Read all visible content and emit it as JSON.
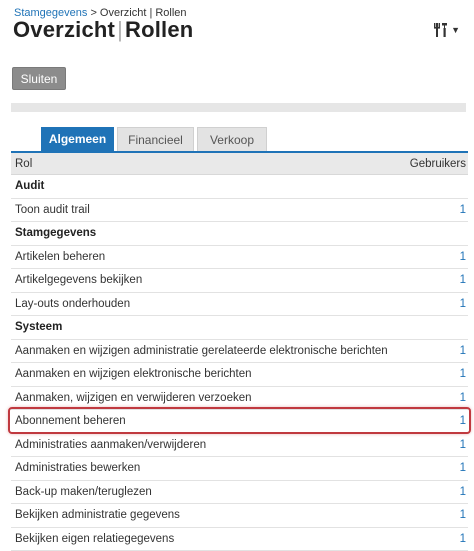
{
  "breadcrumb": {
    "link": "Stamgegevens",
    "rest": "> Overzicht | Rollen"
  },
  "title": {
    "main": "Overzicht",
    "separator": "|",
    "sub": "Rollen"
  },
  "tools": {
    "icon": "tools-icon",
    "caret": "▼"
  },
  "buttons": {
    "close": "Sluiten"
  },
  "tabs": [
    {
      "label": "Algemeen",
      "active": true
    },
    {
      "label": "Financieel",
      "active": false
    },
    {
      "label": "Verkoop",
      "active": false
    }
  ],
  "table": {
    "columns": {
      "role": "Rol",
      "users": "Gebruikers"
    },
    "rows": [
      {
        "label": "Audit",
        "value": "",
        "group": true
      },
      {
        "label": "Toon audit trail",
        "value": "1"
      },
      {
        "label": "Stamgegevens",
        "value": "",
        "group": true
      },
      {
        "label": "Artikelen beheren",
        "value": "1"
      },
      {
        "label": "Artikelgegevens bekijken",
        "value": "1"
      },
      {
        "label": "Lay-outs onderhouden",
        "value": "1"
      },
      {
        "label": "Systeem",
        "value": "",
        "group": true
      },
      {
        "label": "Aanmaken en wijzigen administratie gerelateerde elektronische berichten",
        "value": "1"
      },
      {
        "label": "Aanmaken en wijzigen elektronische berichten",
        "value": "1"
      },
      {
        "label": "Aanmaken, wijzigen en verwijderen verzoeken",
        "value": "1"
      },
      {
        "label": "Abonnement beheren",
        "value": "1",
        "highlighted": true
      },
      {
        "label": "Administraties aanmaken/verwijderen",
        "value": "1"
      },
      {
        "label": "Administraties bewerken",
        "value": "1"
      },
      {
        "label": "Back-up maken/teruglezen",
        "value": "1"
      },
      {
        "label": "Bekijken administratie gegevens",
        "value": "1"
      },
      {
        "label": "Bekijken eigen relatiegegevens",
        "value": "1"
      }
    ]
  },
  "colors": {
    "accent": "#1f73b7",
    "highlight": "#c0393f",
    "button": "#8c8c8c"
  }
}
